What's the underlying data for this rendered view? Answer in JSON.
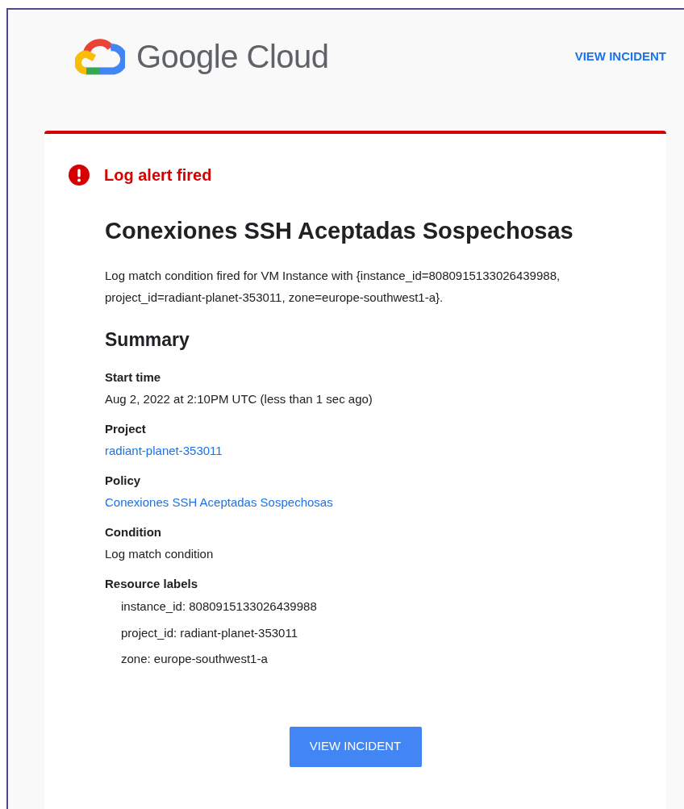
{
  "header": {
    "logo_text": "Google Cloud",
    "link": "VIEW INCIDENT"
  },
  "alert": {
    "status": "Log alert fired",
    "title": "Conexiones SSH Aceptadas Sospechosas",
    "description": "Log match condition fired for VM Instance with {instance_id=8080915133026439988, project_id=radiant-planet-353011, zone=europe-southwest1-a}."
  },
  "summary": {
    "heading": "Summary",
    "fields": [
      {
        "label": "Start time",
        "value": "Aug 2, 2022 at 2:10PM UTC (less than 1 sec ago)",
        "kind": "text"
      },
      {
        "label": "Project",
        "value": "radiant-planet-353011",
        "kind": "link"
      },
      {
        "label": "Policy",
        "value": "Conexiones SSH Aceptadas Sospechosas",
        "kind": "link"
      },
      {
        "label": "Condition",
        "value": "Log match condition",
        "kind": "text"
      }
    ],
    "resource_labels": {
      "label": "Resource labels",
      "items": [
        "instance_id: 8080915133026439988",
        "project_id: radiant-planet-353011",
        "zone: europe-southwest1-a"
      ]
    }
  },
  "button": "VIEW INCIDENT"
}
